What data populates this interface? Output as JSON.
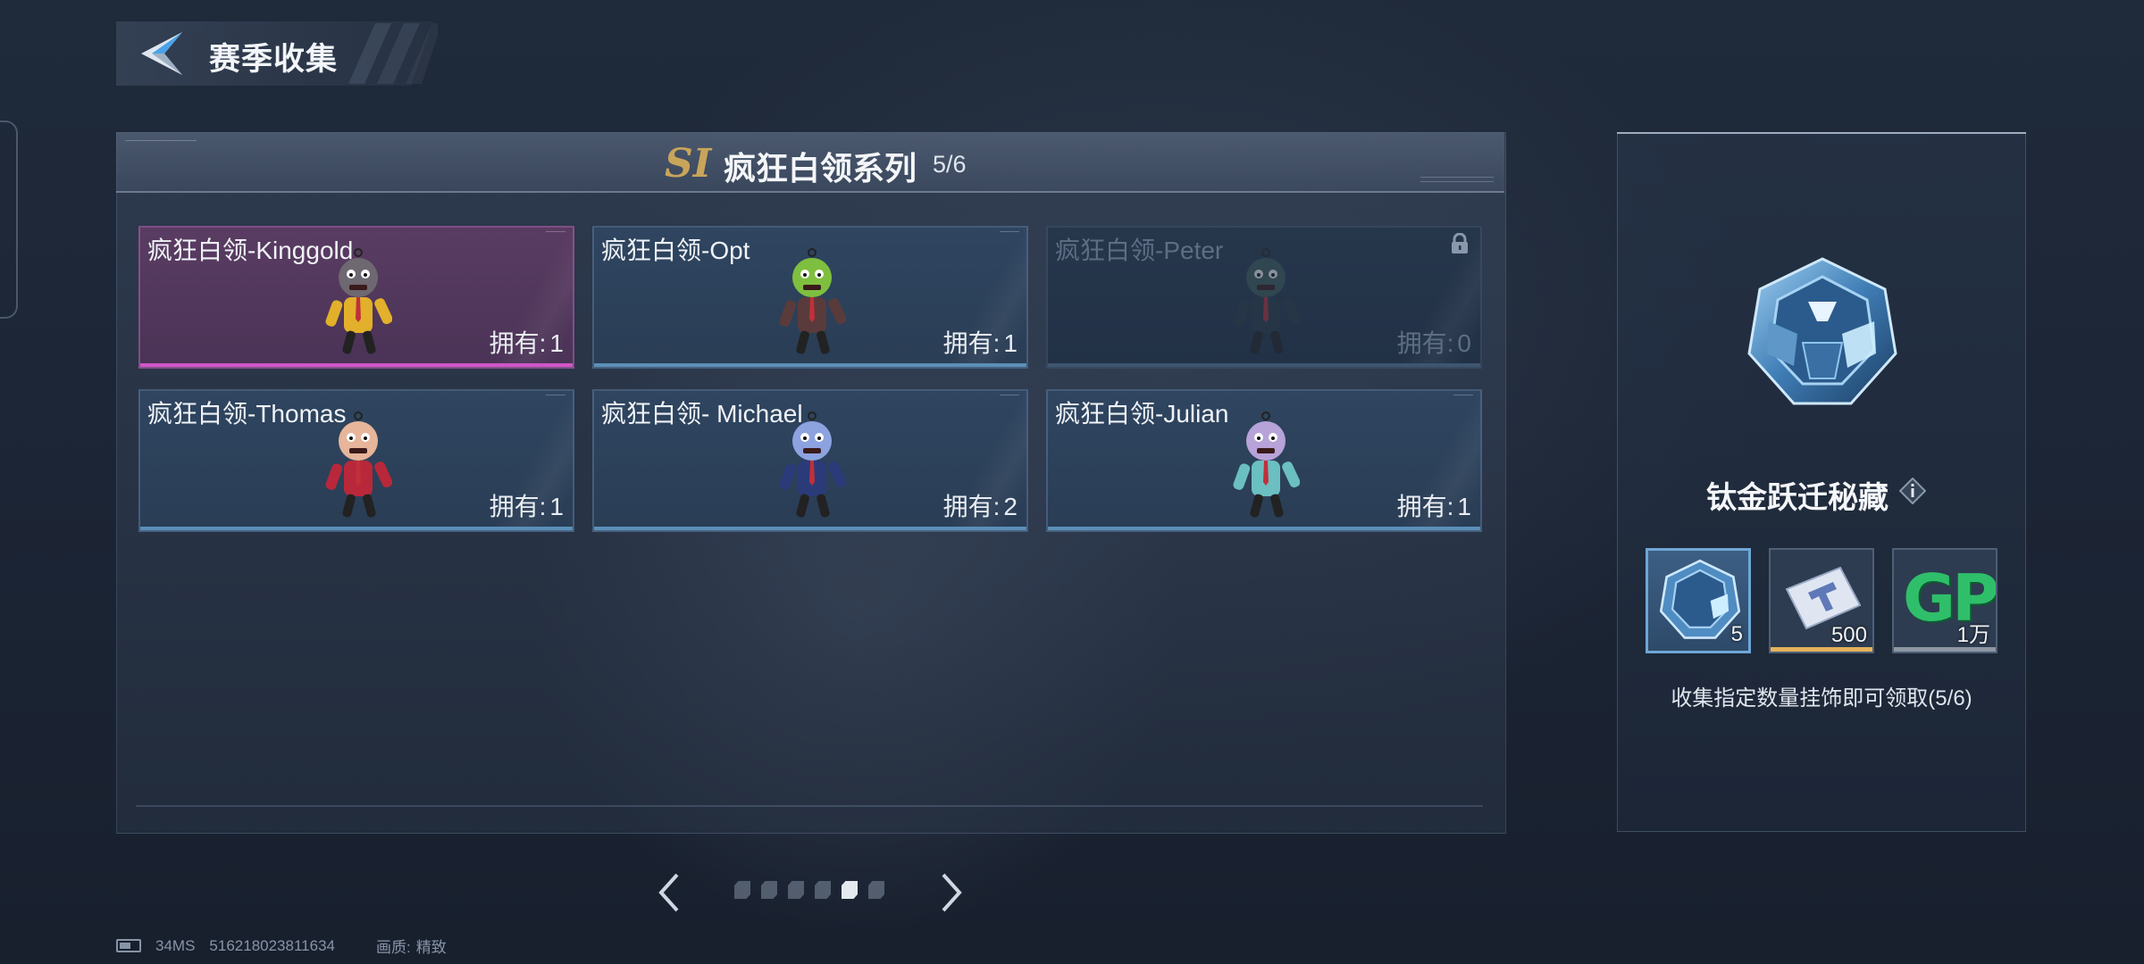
{
  "header": {
    "title": "赛季收集"
  },
  "series": {
    "season_badge": "SI",
    "title": "疯狂白领系列",
    "progress": "5/6"
  },
  "cards": [
    {
      "name": "疯狂白领-Kinggold",
      "owned_label": "拥有:",
      "owned": "1",
      "rarity_color": "#cf56c9",
      "figure_color": "#6e6870",
      "accent": "#e2b02a",
      "locked": false
    },
    {
      "name": "疯狂白领-Opt",
      "owned_label": "拥有:",
      "owned": "1",
      "rarity_color": "#5b8fb8",
      "figure_color": "#7fbf3f",
      "accent": "#5a3b3b",
      "locked": false
    },
    {
      "name": "疯狂白领-Peter",
      "owned_label": "拥有:",
      "owned": "0",
      "rarity_color": "#3e5670",
      "figure_color": "#3f5c5a",
      "accent": "#2c3a46",
      "locked": true
    },
    {
      "name": "疯狂白领-Thomas",
      "owned_label": "拥有:",
      "owned": "1",
      "rarity_color": "#5b8fb8",
      "figure_color": "#e6b59a",
      "accent": "#b8283a",
      "locked": false
    },
    {
      "name": "疯狂白领- Michael",
      "owned_label": "拥有:",
      "owned": "2",
      "rarity_color": "#5b8fb8",
      "figure_color": "#8da3e0",
      "accent": "#2b3a78",
      "locked": false
    },
    {
      "name": "疯狂白领-Julian",
      "owned_label": "拥有:",
      "owned": "1",
      "rarity_color": "#5b8fb8",
      "figure_color": "#b7a3d8",
      "accent": "#6bbfc0",
      "locked": false
    }
  ],
  "pagination": {
    "pages": 6,
    "current": 5
  },
  "footer": {
    "ping": "34MS",
    "uid": "516218023811634",
    "quality_label": "画质:",
    "quality_value": "精致"
  },
  "reward": {
    "name": "钛金跃迁秘藏",
    "items": [
      {
        "icon": "titanium-crate-icon",
        "qty": "5",
        "bar_color": "#6ea7d6",
        "selected": true
      },
      {
        "icon": "ticket-voucher-icon",
        "qty": "500",
        "bar_color": "#e4b25a",
        "selected": false
      },
      {
        "icon": "gp-currency-icon",
        "label": "GP",
        "qty": "1万",
        "bar_color": "#8f97a3",
        "selected": false
      }
    ],
    "description": "收集指定数量挂饰即可领取(5/6)"
  }
}
